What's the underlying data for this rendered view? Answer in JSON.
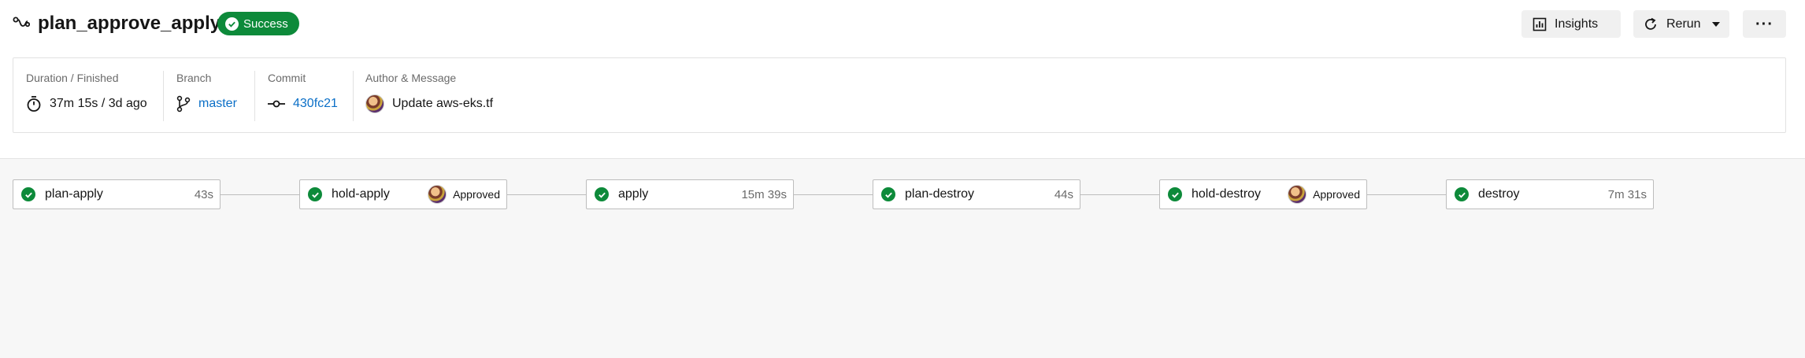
{
  "header": {
    "workflow_name": "plan_approve_apply",
    "status": "Success",
    "insights_label": "Insights",
    "rerun_label": "Rerun",
    "more_label": "···"
  },
  "info": {
    "duration_label": "Duration / Finished",
    "duration_value": "37m 15s / 3d ago",
    "branch_label": "Branch",
    "branch_value": "master",
    "commit_label": "Commit",
    "commit_value": "430fc21",
    "author_label": "Author & Message",
    "commit_message": "Update aws-eks.tf"
  },
  "jobs": [
    {
      "name": "plan-apply",
      "duration": "43s"
    },
    {
      "name": "hold-apply",
      "status": "Approved"
    },
    {
      "name": "apply",
      "duration": "15m 39s"
    },
    {
      "name": "plan-destroy",
      "duration": "44s"
    },
    {
      "name": "hold-destroy",
      "status": "Approved"
    },
    {
      "name": "destroy",
      "duration": "7m 31s"
    }
  ],
  "colors": {
    "success": "#0d8a3a",
    "link": "#0b6fc7",
    "border": "#bdbdbd"
  }
}
